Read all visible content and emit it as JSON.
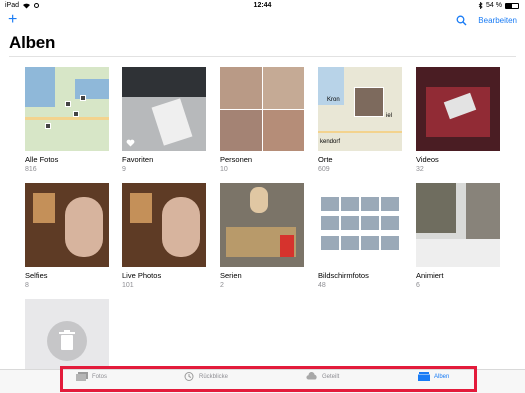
{
  "status": {
    "device": "iPad",
    "time": "12:44",
    "battery_text": "54 %",
    "battery_level": 0.54
  },
  "nav": {
    "add_symbol": "+",
    "edit_label": "Bearbeiten"
  },
  "title": "Alben",
  "albums": [
    {
      "name": "Alle Fotos",
      "count": "816"
    },
    {
      "name": "Favoriten",
      "count": "9"
    },
    {
      "name": "Personen",
      "count": "10"
    },
    {
      "name": "Orte",
      "count": "609"
    },
    {
      "name": "Videos",
      "count": "32"
    },
    {
      "name": "Selfies",
      "count": "8"
    },
    {
      "name": "Live Photos",
      "count": "101"
    },
    {
      "name": "Serien",
      "count": "2"
    },
    {
      "name": "Bildschirmfotos",
      "count": "48"
    },
    {
      "name": "Animiert",
      "count": "6"
    }
  ],
  "places_labels": {
    "a": "Kron",
    "b": "iel",
    "c": "kendorf"
  },
  "tabs": [
    {
      "label": "Fotos",
      "icon": "photos-icon",
      "active": false
    },
    {
      "label": "Rückblicke",
      "icon": "memories-icon",
      "active": false
    },
    {
      "label": "Geteilt",
      "icon": "shared-cloud-icon",
      "active": false
    },
    {
      "label": "Alben",
      "icon": "albums-icon",
      "active": true
    }
  ],
  "colors": {
    "accent": "#1a7cf5",
    "highlight": "#e31b3b"
  }
}
